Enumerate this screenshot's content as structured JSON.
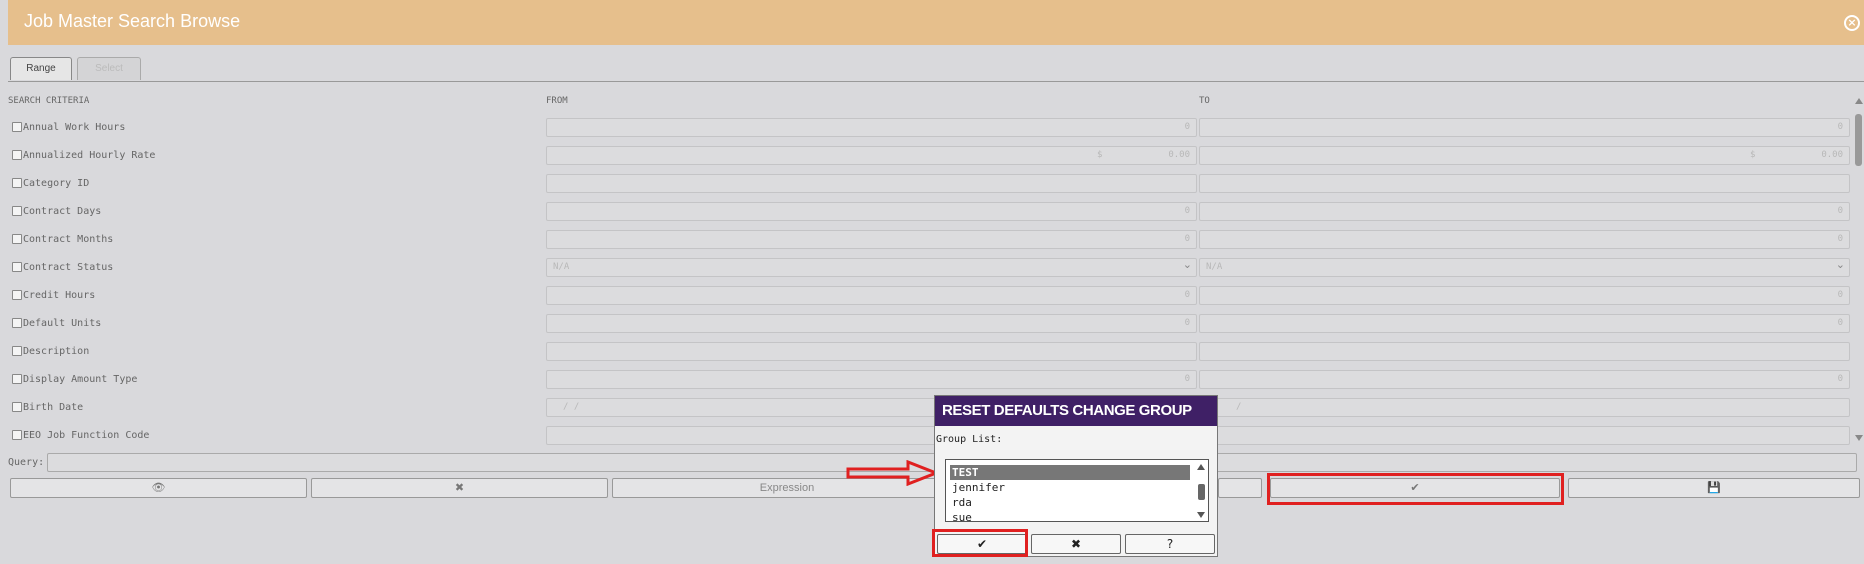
{
  "window": {
    "title": "Job Master Search Browse",
    "close_icon": "close-circle-icon"
  },
  "tabs": [
    {
      "label": "Range",
      "active": true
    },
    {
      "label": "Select",
      "active": false
    }
  ],
  "criteria_header": {
    "search": "SEARCH CRITERIA",
    "from": "FROM",
    "to": "TO"
  },
  "rows": [
    {
      "label": "Annual Work Hours",
      "from": "0",
      "to": "0",
      "kind": "num"
    },
    {
      "label": "Annualized Hourly Rate",
      "from_currency": "$",
      "from": "0.00",
      "to_currency": "$",
      "to": "0.00",
      "kind": "money"
    },
    {
      "label": "Category ID",
      "from": "",
      "to": "",
      "kind": "text"
    },
    {
      "label": "Contract Days",
      "from": "0",
      "to": "0",
      "kind": "num"
    },
    {
      "label": "Contract Months",
      "from": "0",
      "to": "0",
      "kind": "num"
    },
    {
      "label": "Contract Status",
      "from": "N/A",
      "to": "N/A",
      "kind": "select"
    },
    {
      "label": "Credit Hours",
      "from": "0",
      "to": "0",
      "kind": "num"
    },
    {
      "label": "Default Units",
      "from": "0",
      "to": "0",
      "kind": "num"
    },
    {
      "label": "Description",
      "from": "",
      "to": "",
      "kind": "text"
    },
    {
      "label": "Display Amount Type",
      "from": "0",
      "to": "0",
      "kind": "num"
    },
    {
      "label": "Birth Date",
      "from": "/  /",
      "to": "/",
      "kind": "date"
    },
    {
      "label": "EEO Job Function Code",
      "from": "",
      "to": "",
      "kind": "text"
    }
  ],
  "query": {
    "label": "Query:",
    "value": ""
  },
  "buttons": {
    "view_icon": "eye-icon",
    "clear_icon": "close-circle-icon",
    "expression_label": "Expression",
    "ok_icon": "check-circle-icon",
    "save_icon": "save-icon"
  },
  "dialog": {
    "title": "RESET DEFAULTS CHANGE GROUP",
    "group_label": "Group List:",
    "groups": [
      "TEST",
      "jennifer",
      "rda",
      "sue"
    ],
    "selected": "TEST",
    "ok_icon": "check-circle-icon",
    "cancel_icon": "close-circle-icon",
    "help_icon": "help-circle-icon"
  },
  "annotation_color": "#e02020"
}
